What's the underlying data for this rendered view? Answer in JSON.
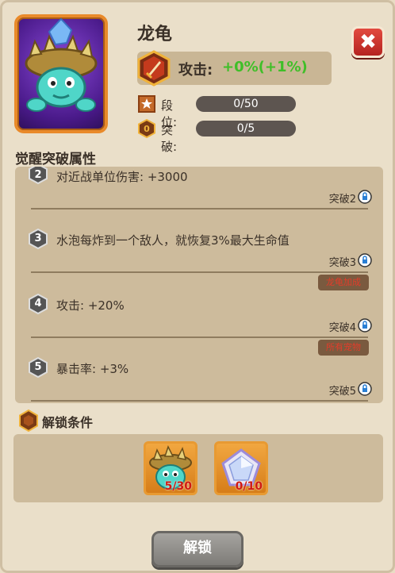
{
  "hero": {
    "name": "龙龟",
    "portrait_icon": "dragon-turtle-icon"
  },
  "attack": {
    "label": "攻击:",
    "value": "+0%(+1%)",
    "icon": "sword-icon",
    "value_color": "#3fbf28"
  },
  "stats": [
    {
      "label": "段位:",
      "value": "0/50",
      "icon": "star-icon"
    },
    {
      "label": "突破:",
      "value": "0/5",
      "icon": "breakthrough-icon"
    }
  ],
  "attributes_title": "觉醒突破属性",
  "attributes": [
    {
      "num": "2",
      "text": "对近战单位伤害: +3000",
      "req": "突破2",
      "tag": ""
    },
    {
      "num": "3",
      "text": "水泡每炸到一个敌人，就恢复3%最大生命值",
      "req": "突破3",
      "tag": "龙龟加成"
    },
    {
      "num": "4",
      "text": "攻击: +20%",
      "req": "突破4",
      "tag": "所有宠物"
    },
    {
      "num": "5",
      "text": "暴击率: +3%",
      "req": "突破5",
      "tag": ""
    }
  ],
  "unlock": {
    "title": "解锁条件",
    "items": [
      {
        "icon": "dragon-turtle-shard-icon",
        "count": "5/30"
      },
      {
        "icon": "crystal-pentagon-icon",
        "count": "0/10"
      }
    ],
    "button_label": "解锁"
  },
  "close_label": "✖"
}
